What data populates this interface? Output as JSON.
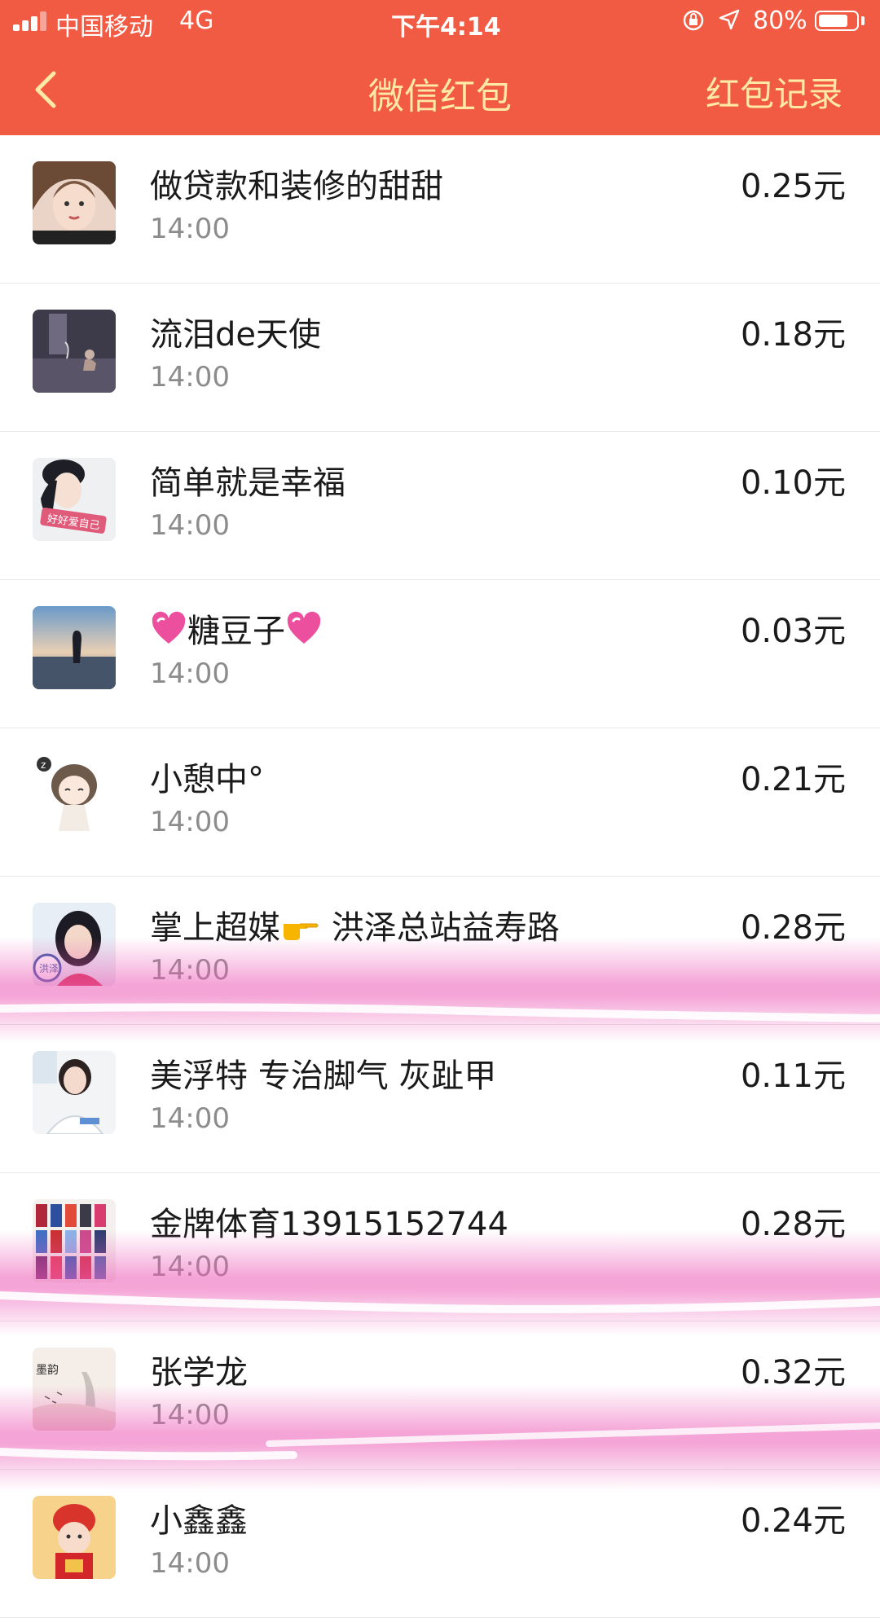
{
  "status_bar": {
    "carrier": "中国移动",
    "network": "4G",
    "time": "下午4:14",
    "battery_percent_text": "80%",
    "battery_level": 0.8
  },
  "navbar": {
    "back_icon": "chevron-left-icon",
    "title": "微信红包",
    "record_label": "红包记录"
  },
  "colors": {
    "header": "#f15b44",
    "header_text": "#ffe8a8",
    "highlight": "#ec5ab5"
  },
  "records": [
    {
      "name": "做贷款和装修的甜甜",
      "time": "14:00",
      "amount": "0.25元"
    },
    {
      "name": "流泪de天使",
      "time": "14:00",
      "amount": "0.18元"
    },
    {
      "name": "简单就是幸福",
      "time": "14:00",
      "amount": "0.10元",
      "avatar_text": "好好爱自己"
    },
    {
      "name_before": "",
      "name": "糖豆子",
      "name_after": "",
      "time": "14:00",
      "amount": "0.03元",
      "emoji": "sparkling-heart-icon"
    },
    {
      "name": "小憩中°",
      "time": "14:00",
      "amount": "0.21元"
    },
    {
      "name_a": "掌上超媒",
      "name_b": " 洪泽总站益寿路",
      "time": "14:00",
      "amount": "0.28元",
      "emoji": "pointing-hand-icon",
      "avatar_text": "洪泽"
    },
    {
      "name": "美浮特 专治脚气 灰趾甲",
      "time": "14:00",
      "amount": "0.11元"
    },
    {
      "name": "金牌体育13915152744",
      "time": "14:00",
      "amount": "0.28元"
    },
    {
      "name": "张学龙",
      "time": "14:00",
      "amount": "0.32元",
      "avatar_text": "墨韵"
    },
    {
      "name": "小鑫鑫",
      "time": "14:00",
      "amount": "0.24元"
    }
  ]
}
